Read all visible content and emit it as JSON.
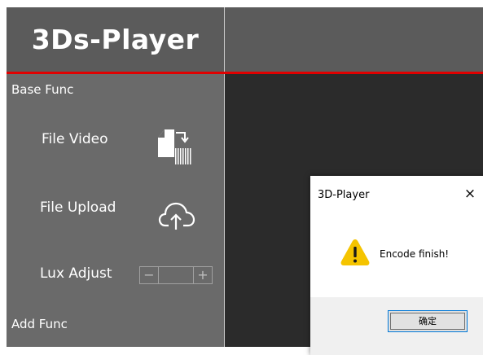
{
  "app": {
    "title": "3Ds-Player"
  },
  "sidebar": {
    "sections": [
      {
        "label": "Base Func",
        "items": [
          {
            "label": "File Video",
            "icon": "video-file-icon"
          },
          {
            "label": "File Upload",
            "icon": "cloud-upload-icon"
          },
          {
            "label": "Lux Adjust",
            "icon": "stepper"
          }
        ]
      },
      {
        "label": "Add Func",
        "items": []
      }
    ],
    "stepper": {
      "minus": "−",
      "plus": "+"
    }
  },
  "dialog": {
    "title": "3D-Player",
    "close": "×",
    "message": "Encode finish!",
    "icon": "warning-icon",
    "ok_label": "确定"
  },
  "colors": {
    "accent_line": "#e00000",
    "sidebar_bg": "#6a6a6a",
    "header_bg": "#5b5b5b",
    "content_bg": "#2b2b2b",
    "warning": "#f5c400"
  }
}
